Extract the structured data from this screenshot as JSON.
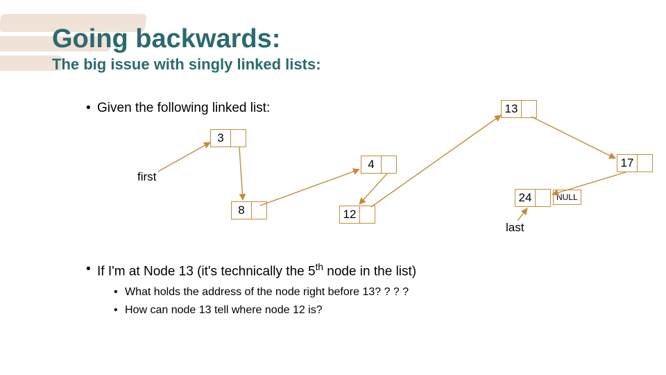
{
  "header": {
    "title": "Going backwards:",
    "subtitle": "The big issue with singly linked lists:"
  },
  "bullets": {
    "b1": "Given the following linked list:",
    "b2_pre": "If I'm at Node 13 (it's technically the 5",
    "b2_sup": "th",
    "b2_post": " node in the list)",
    "b2a": "What holds the address of the node right before 13? ? ? ?",
    "b2b": "How can node 13 tell where node 12 is?"
  },
  "labels": {
    "first": "first",
    "last": "last",
    "null": "NULL"
  },
  "nodes": {
    "n3": "3",
    "n4": "4",
    "n8": "8",
    "n12": "12",
    "n13": "13",
    "n17": "17",
    "n24": "24"
  },
  "chart_data": {
    "type": "diagram",
    "structure": "singly-linked-list",
    "order": [
      3,
      8,
      4,
      12,
      13,
      17,
      24
    ],
    "first": 3,
    "last": 24,
    "terminal": "NULL",
    "nodes": [
      {
        "value": 3,
        "next": 8
      },
      {
        "value": 8,
        "next": 4
      },
      {
        "value": 4,
        "next": 12
      },
      {
        "value": 12,
        "next": 13
      },
      {
        "value": 13,
        "next": 17
      },
      {
        "value": 17,
        "next": 24
      },
      {
        "value": 24,
        "next": null
      }
    ]
  },
  "colors": {
    "accent": "#2b6a6e",
    "arrow": "#c68a3a",
    "brush": "#f0e2d6"
  }
}
